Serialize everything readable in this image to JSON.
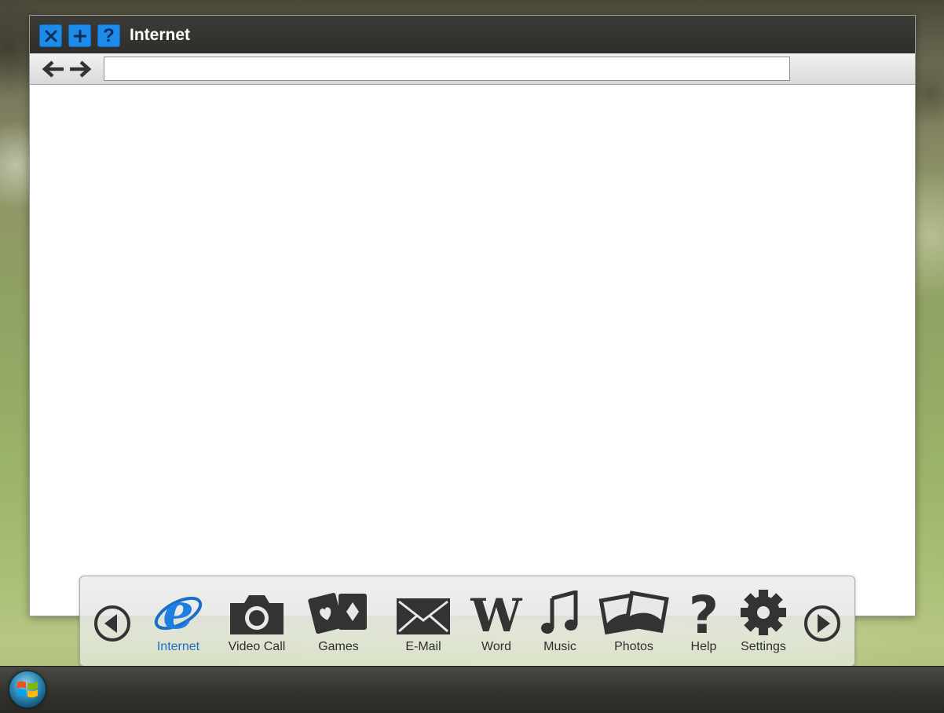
{
  "window": {
    "title": "Internet",
    "buttons": {
      "close_icon": "close-icon",
      "add_icon": "plus-icon",
      "help_label": "?"
    }
  },
  "navbar": {
    "back_icon": "arrow-left-icon",
    "forward_icon": "arrow-right-icon",
    "address_value": "",
    "address_placeholder": ""
  },
  "dock": {
    "items": [
      {
        "label": "Internet",
        "icon": "internet-explorer-icon",
        "active": true
      },
      {
        "label": "Video Call",
        "icon": "camera-icon"
      },
      {
        "label": "Games",
        "icon": "playing-cards-icon"
      },
      {
        "label": "E-Mail",
        "icon": "envelope-icon"
      },
      {
        "label": "Word",
        "icon": "word-w-icon"
      },
      {
        "label": "Music",
        "icon": "music-note-icon"
      },
      {
        "label": "Photos",
        "icon": "photos-icon"
      },
      {
        "label": "Help",
        "icon": "question-mark-icon"
      },
      {
        "label": "Settings",
        "icon": "gear-icon"
      }
    ],
    "word_glyph": "W",
    "help_glyph": "?"
  },
  "taskbar": {
    "start_icon": "windows-logo-icon"
  },
  "colors": {
    "accent": "#1d8be8",
    "active_label": "#1a6ec7",
    "titlebar": "#333230",
    "icon_dark": "#333333"
  }
}
